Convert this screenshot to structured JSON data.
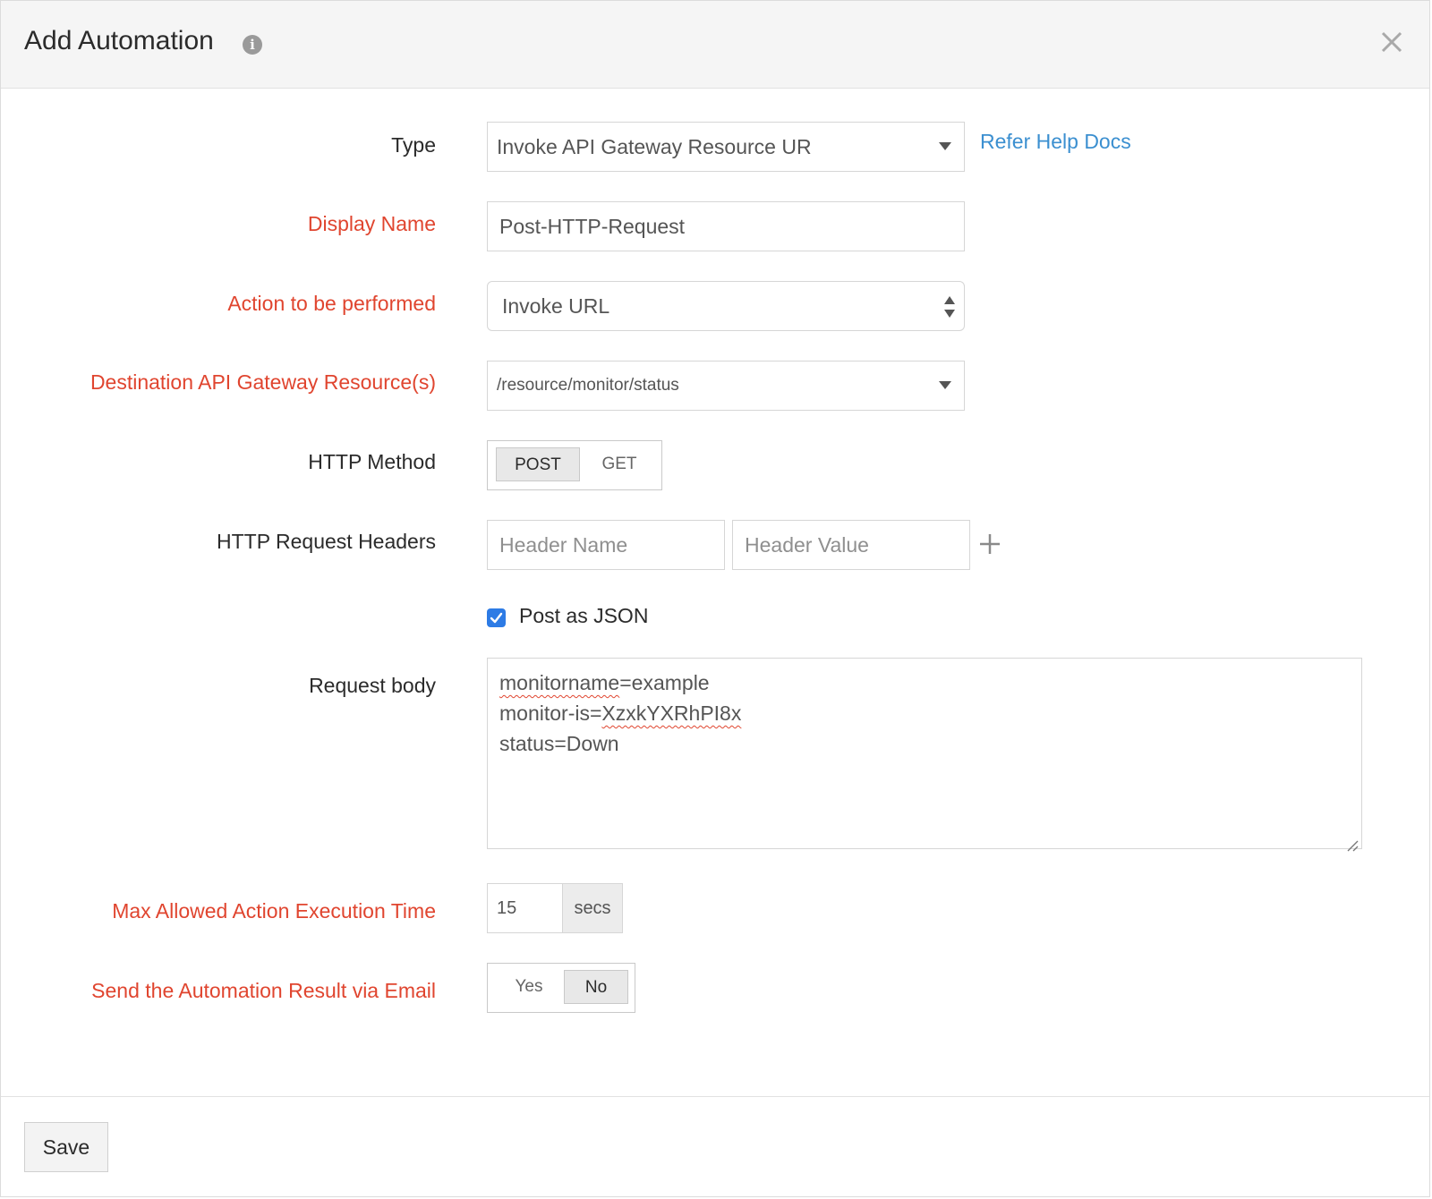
{
  "dialog": {
    "title": "Add Automation",
    "close_icon": "close-icon",
    "info_icon": "info-icon"
  },
  "form": {
    "type": {
      "label": "Type",
      "value": "Invoke API Gateway Resource UR",
      "help_link": "Refer Help Docs"
    },
    "display_name": {
      "label": "Display Name",
      "value": "Post-HTTP-Request"
    },
    "action": {
      "label": "Action to be performed",
      "value": "Invoke URL"
    },
    "destination": {
      "label": "Destination API Gateway Resource(s)",
      "value": "/resource/monitor/status"
    },
    "http_method": {
      "label": "HTTP Method",
      "options": [
        "POST",
        "GET"
      ],
      "selected": "POST"
    },
    "headers": {
      "label": "HTTP Request Headers",
      "name_placeholder": "Header Name",
      "value_placeholder": "Header Value"
    },
    "post_as_json": {
      "label": "Post as JSON",
      "checked": true
    },
    "request_body": {
      "label": "Request body",
      "lines": [
        {
          "pre": "",
          "spell": "monitorname",
          "post": "=example"
        },
        {
          "pre": "monitor-is=",
          "spell": "XzxkYXRhPI8x",
          "post": ""
        },
        {
          "pre": "status=Down",
          "spell": "",
          "post": ""
        }
      ]
    },
    "max_time": {
      "label": "Max Allowed Action Execution Time",
      "value": "15",
      "unit": "secs"
    },
    "send_email": {
      "label": "Send the Automation Result via Email",
      "options": [
        "Yes",
        "No"
      ],
      "selected": "No"
    }
  },
  "footer": {
    "save_label": "Save"
  },
  "colors": {
    "required_label": "#e0452f",
    "link": "#3b8fd0",
    "checkbox": "#2d7be5"
  }
}
